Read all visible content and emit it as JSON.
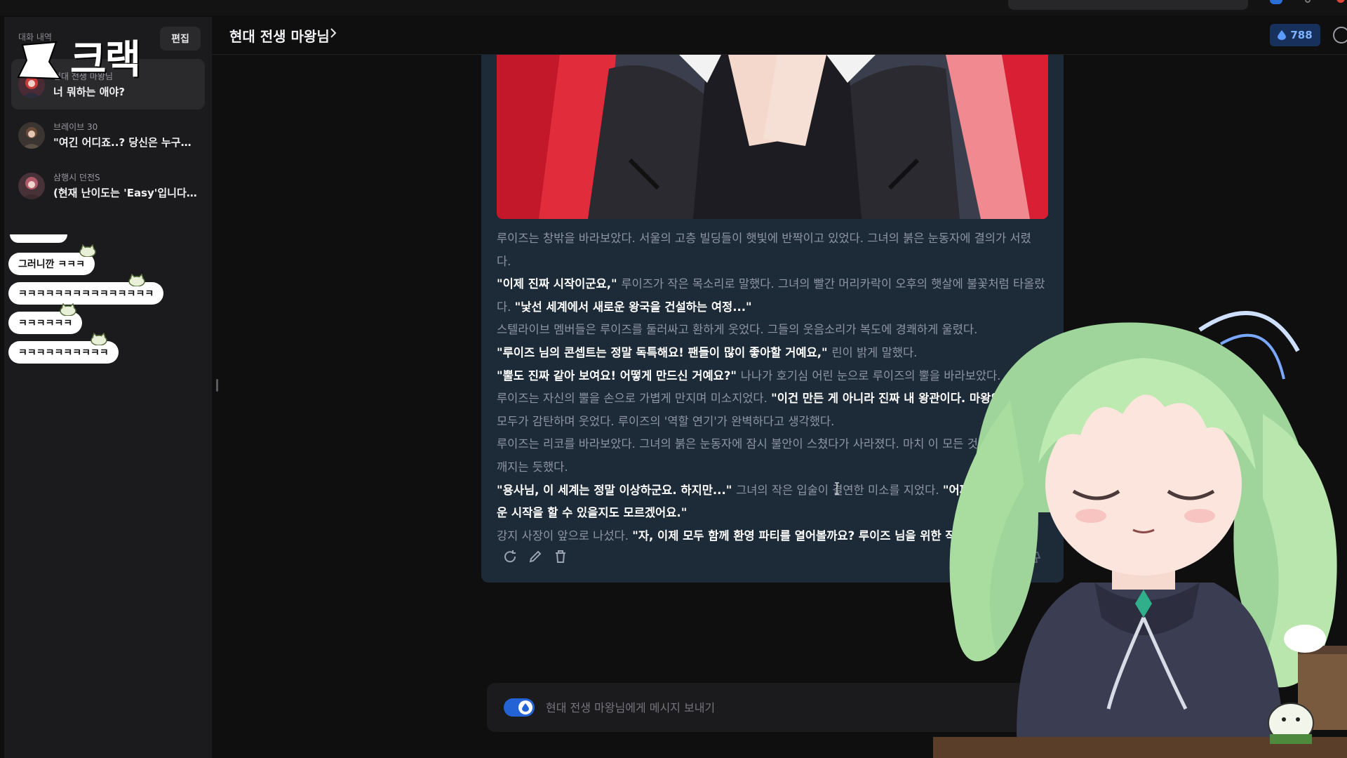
{
  "topbar": {
    "logo_text": "",
    "search_placeholder": ""
  },
  "sidebar": {
    "heading": "대화 내역",
    "edit_label": "편집",
    "logo_text": "크랙",
    "chats": [
      {
        "name": "현대 전생 마왕님",
        "preview": "너 뭐하는 애야?",
        "active": true
      },
      {
        "name": "브레이브 30",
        "preview": "\"여긴 어디죠..? 당신은 누구인...",
        "active": false
      },
      {
        "name": "삼행시 던전S",
        "preview": "(현재 난이도는 'Easy'입니다. ...",
        "active": false
      }
    ]
  },
  "stream_chat": {
    "messages": [
      "그러니깐 ㅋㅋㅋ",
      "ㅋㅋㅋㅋㅋㅋㅋㅋㅋㅋㅋㅋㅋㅋㅋ",
      "ㅋㅋㅋㅋㅋㅋ",
      "ㅋㅋㅋㅋㅋㅋㅋㅋㅋㅋ"
    ]
  },
  "header": {
    "title": "현대 전생 마왕님",
    "points": "788"
  },
  "message": {
    "lines": [
      [
        {
          "t": "루이즈는 창밖을 바라보았다. 서울의 고층 빌딩들이 햇빛에 반짝이고 있었다. 그녀의 붉은 눈동자에 결의가 서렸",
          "s": "nar"
        }
      ],
      [
        {
          "t": "다.",
          "s": "nar"
        }
      ],
      [
        {
          "t": "\"이제 진짜 시작이군요,\" ",
          "s": "dia"
        },
        {
          "t": "루이즈가 작은 목소리로 말했다. 그녀의 빨간 머리카락이 오후의 햇살에 불꽃처럼 타올랐",
          "s": "nar"
        }
      ],
      [
        {
          "t": "다. ",
          "s": "nar"
        },
        {
          "t": "\"낯선 세계에서 새로운 왕국을 건설하는 여정...\"",
          "s": "dia"
        }
      ],
      [
        {
          "t": "스텔라이브 멤버들은 루이즈를 둘러싸고 환하게 웃었다. 그들의 웃음소리가 복도에 경쾌하게 울렸다.",
          "s": "nar"
        }
      ],
      [
        {
          "t": "\"루이즈 님의 콘셉트는 정말 독특해요! 팬들이 많이 좋아할 거예요,\" ",
          "s": "dia"
        },
        {
          "t": "린이 밝게 말했다.",
          "s": "nar"
        }
      ],
      [
        {
          "t": "\"뿔도 진짜 같아 보여요! 어떻게 만드신 거예요?\" ",
          "s": "dia"
        },
        {
          "t": "나나가 호기심 어린 눈으로 루이즈의 뿔을 바라보았다.",
          "s": "nar"
        }
      ],
      [
        {
          "t": "루이즈는 자신의 뿔을 손으로 가볍게 만지며 미소지었다. ",
          "s": "nar"
        },
        {
          "t": "\"이건 만든 게 아니라 진짜 내 왕관이다. 마왕의 증표",
          "s": "dia"
        }
      ],
      [
        {
          "t": "모두가 감탄하며 웃었다. 루이즈의 '역할 연기'가 완벽하다고 생각했다.",
          "s": "nar"
        }
      ],
      [
        {
          "t": "루이즈는 리코를 바라보았다. 그녀의 붉은 눈동자에 잠시 불안이 스쳤다가 사라졌다. 마치 이 모든 것이 꿈",
          "s": "nar"
        }
      ],
      [
        {
          "t": "깨지는 듯했다.",
          "s": "nar"
        }
      ],
      [
        {
          "t": "\"용사님, 이 세계는 정말 이상하군요. 하지만...\" ",
          "s": "dia"
        },
        {
          "t": "그녀의 작은 입술이 결연한 미소를 지었다. ",
          "s": "nar"
        },
        {
          "t": "\"어쩌면 이곳",
          "s": "dia"
        }
      ],
      [
        {
          "t": "운 시작을 할 수 있을지도 모르겠어요.\"",
          "s": "dia"
        }
      ],
      [
        {
          "t": "강지 사장이 앞으로 나섰다. ",
          "s": "nar"
        },
        {
          "t": "\"자, 이제 모두 함께 환영 파티를 열어볼까요? 루이즈 님을 위한 작은 축하",
          "s": "dia"
        }
      ]
    ]
  },
  "composer": {
    "placeholder": "현대 전생 마왕님에게 메시지 보내기"
  },
  "colors": {
    "accent": "#2463d6",
    "card_bg": "#1d2a38",
    "sidebar_bg": "#1b1b1d",
    "brand_red": "#e0473a"
  }
}
